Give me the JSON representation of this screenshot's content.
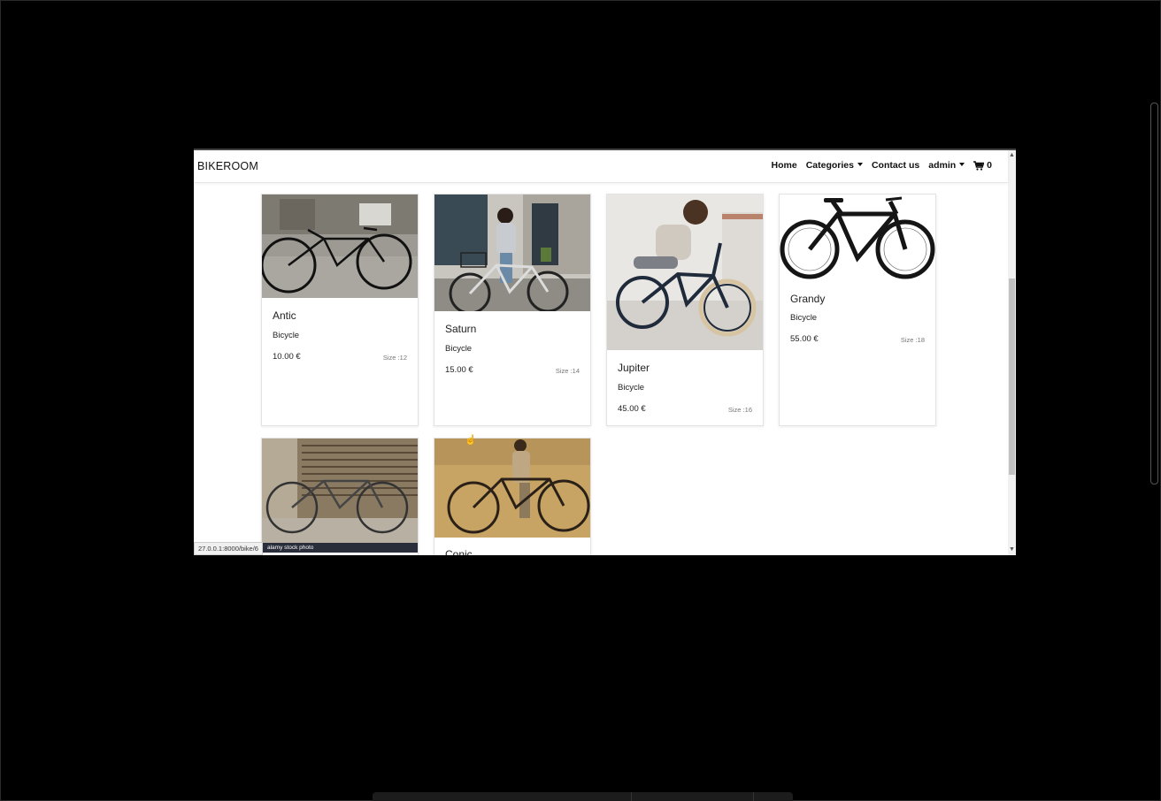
{
  "navbar": {
    "brand": "BIKEROOM",
    "links": {
      "home": "Home",
      "categories": "Categories",
      "contact": "Contact us",
      "user": "admin"
    },
    "cart_count": "0"
  },
  "products": [
    {
      "name": "Antic",
      "category": "Bicycle",
      "price": "10.00 €",
      "size": "Size :12"
    },
    {
      "name": "Saturn",
      "category": "Bicycle",
      "price": "15.00 €",
      "size": "Size :14"
    },
    {
      "name": "Jupiter",
      "category": "Bicycle",
      "price": "45.00 €",
      "size": "Size :16"
    },
    {
      "name": "Grandy",
      "category": "Bicycle",
      "price": "55.00 €",
      "size": "Size :18"
    },
    {
      "name": "",
      "category": "",
      "price": "",
      "size": ""
    },
    {
      "name": "Conic",
      "category": "",
      "price": "",
      "size": ""
    }
  ],
  "watermark": "alamy stock photo",
  "status_url": "27.0.0.1:8000/bike/6",
  "icons": {
    "cart": "cart-icon",
    "cursor": "hand-pointer-icon"
  }
}
